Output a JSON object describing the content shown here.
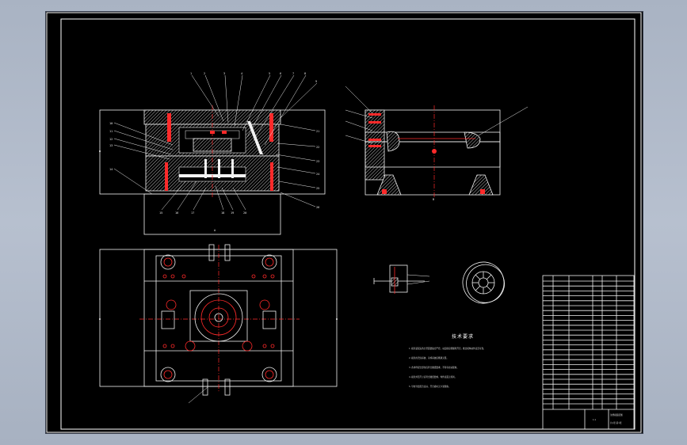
{
  "drawing": {
    "background": "#000000",
    "line_color": "#f2f2f2",
    "centerline_color": "#ff2a2a",
    "balloons_top": [
      "1",
      "2",
      "3",
      "4",
      "5",
      "6",
      "7",
      "8",
      "9"
    ],
    "balloons_left": [
      "10",
      "11",
      "12",
      "13",
      "14"
    ],
    "balloons_bottom": [
      "15",
      "16",
      "17",
      "18",
      "19",
      "20"
    ],
    "balloons_right": [
      "21",
      "22",
      "23",
      "24",
      "25",
      "26"
    ],
    "section_labels": [
      "A",
      "B"
    ],
    "tech_title": "技术要求",
    "tech_lines": [
      "1. 模具装配后各分型面要贴合严密，动定模应能顺利开合，推出机构动作灵活可靠。",
      "2. 模具的浇注系统、冷却系统应畅通无阻。",
      "3. 各零件配合部位应符合图纸要求，不得有松动现象。",
      "4. 模具外形尺寸应符合图纸要求，零件表面无毛刺。",
      "5. 导柱导套配合良好，开合模时无卡滞现象。"
    ],
    "title_block": {
      "name": "注塑模装配图",
      "scale": "1:1",
      "sheet": "共1张 第1张"
    }
  }
}
